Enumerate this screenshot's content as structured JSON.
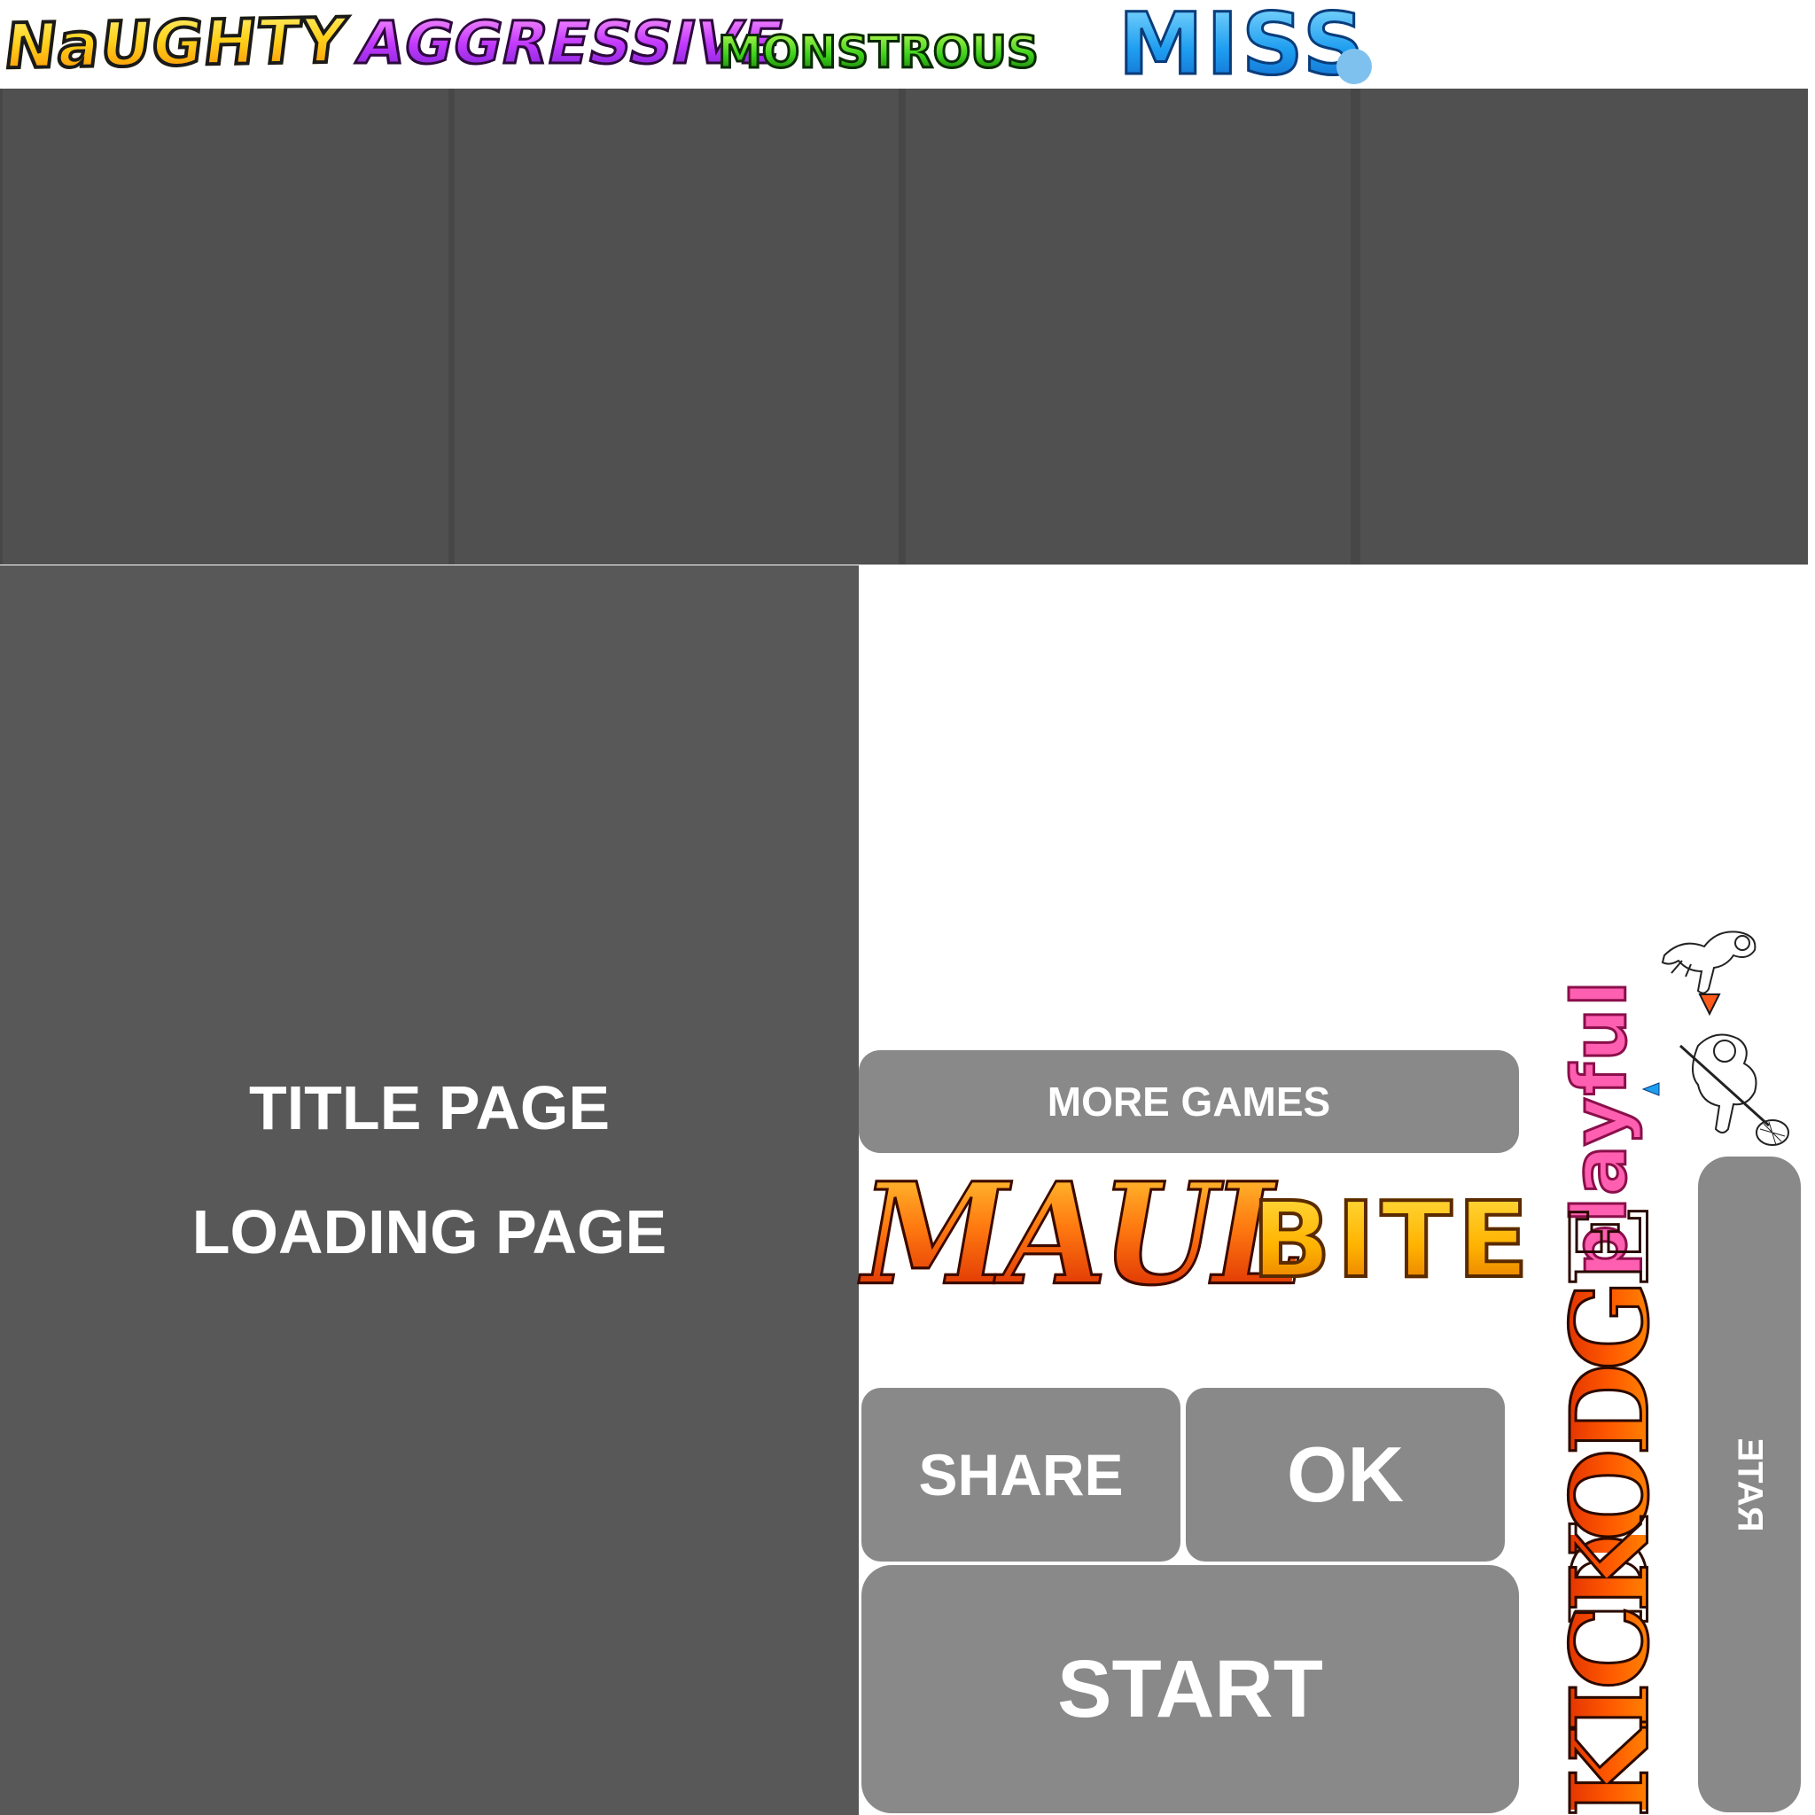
{
  "logo": {
    "word1": "NaUGHTY",
    "word2": "AGGRESSIVE",
    "word3": "MONSTROUS",
    "word4": "MISS"
  },
  "title_page": {
    "line1": "TITLE PAGE",
    "line2": "LOADING PAGE"
  },
  "buttons": {
    "more_games": "MORE GAMES",
    "share": "SHARE",
    "ok": "OK",
    "start": "START",
    "rate": "RATE"
  },
  "word_art": {
    "maul": "MAUL",
    "bite": "BITE",
    "playful": "playful",
    "kick": "KICK",
    "dodge": "DODGE"
  },
  "colors": {
    "panel": "#505050",
    "title_page": "#585858",
    "button": "#898989",
    "dot": "#7fc1ee"
  },
  "icons": [
    "running-girl-sprite",
    "girl-with-net-sprite",
    "red-arrow-marker-icon",
    "blue-arrow-marker-icon"
  ]
}
